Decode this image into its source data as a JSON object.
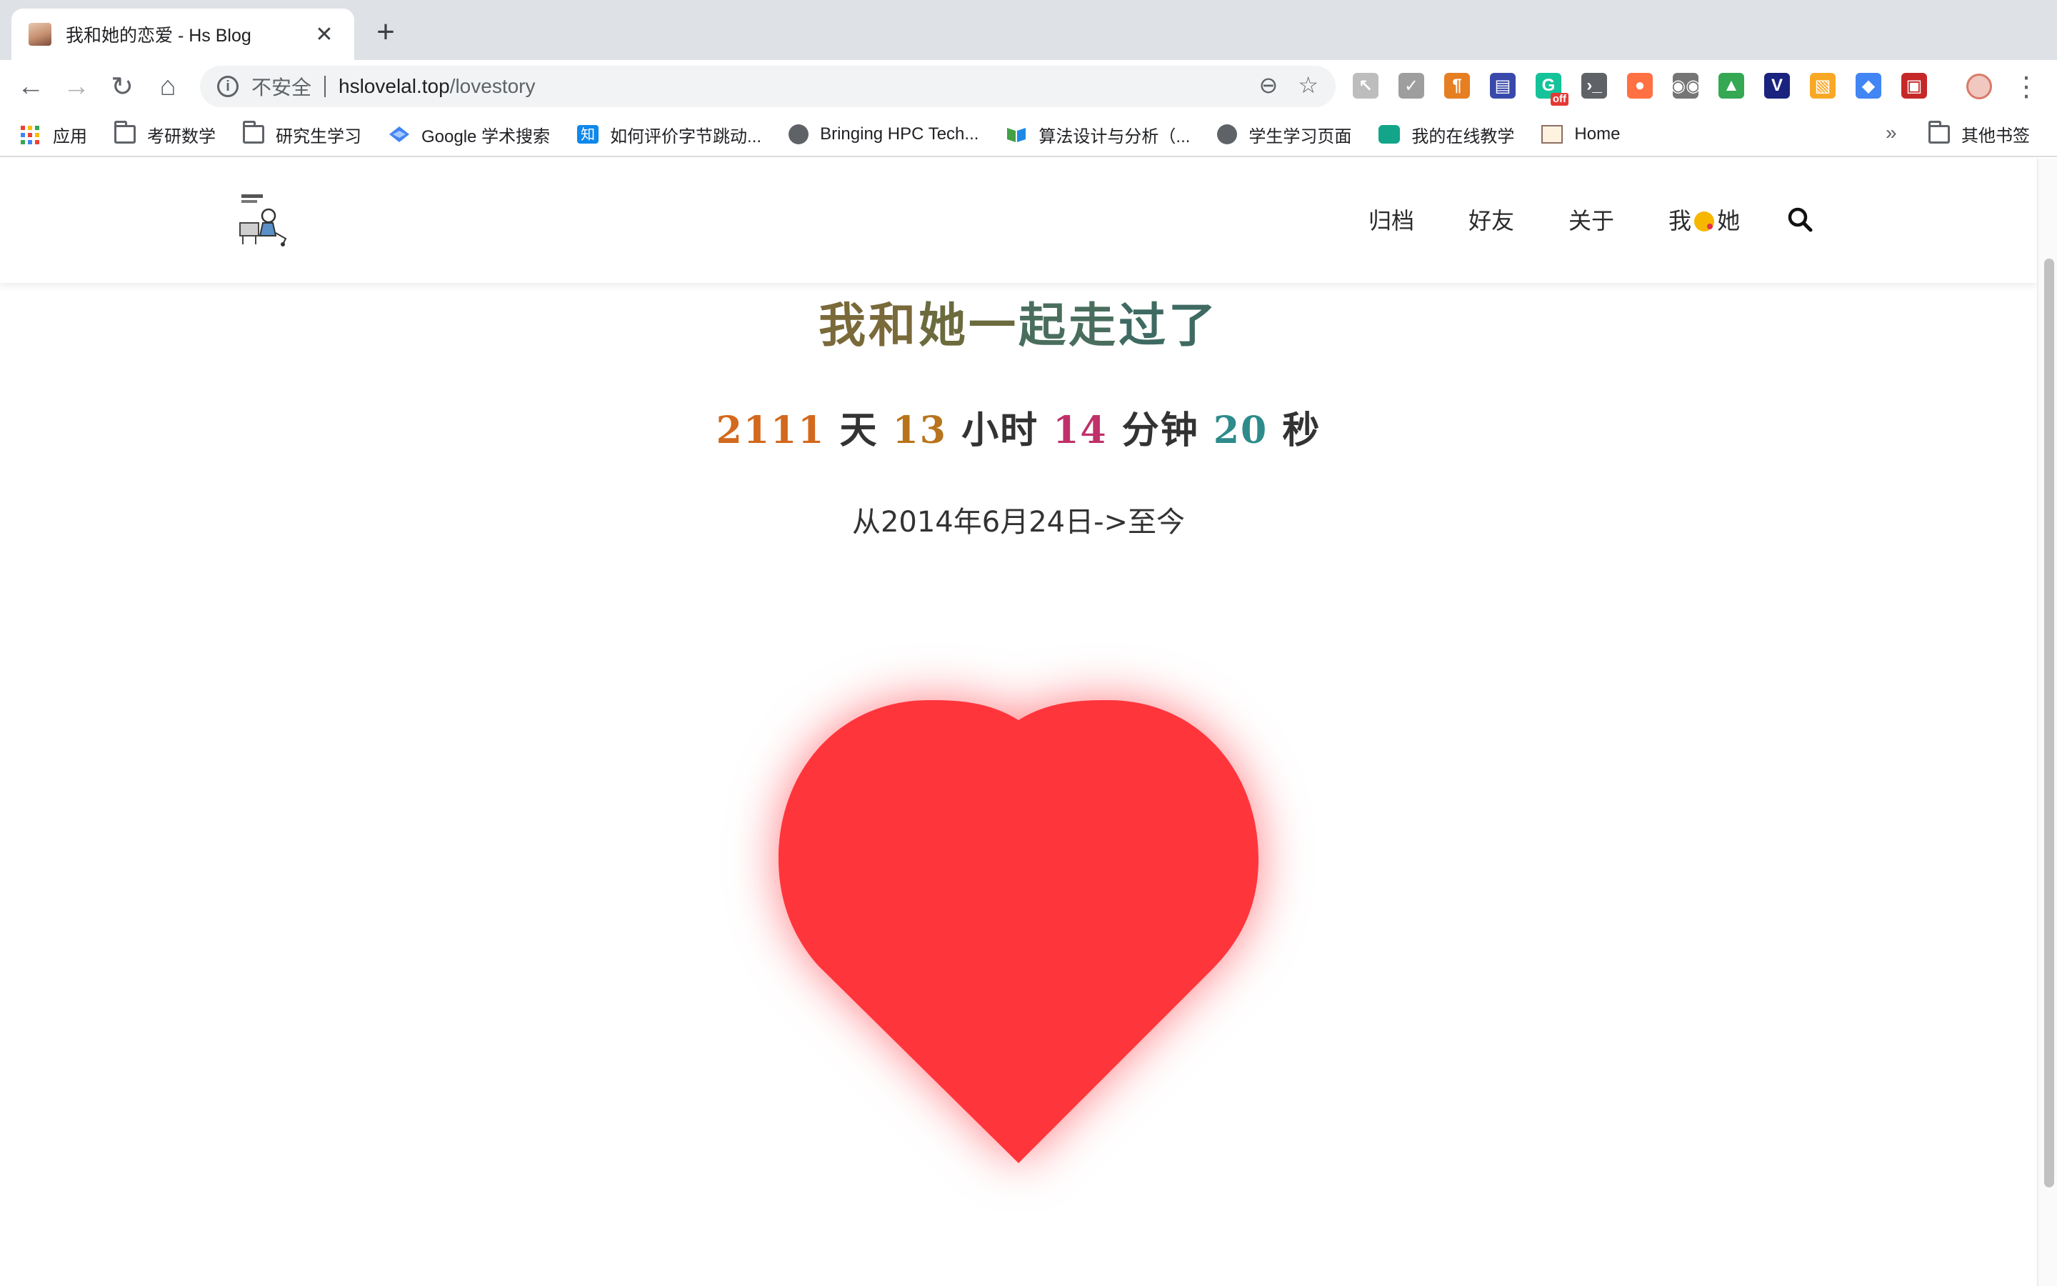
{
  "browser": {
    "tab_title": "我和她的恋爱 - Hs Blog",
    "tab_close": "✕",
    "new_tab": "+",
    "nav": {
      "back": "←",
      "forward": "→",
      "reload": "↻",
      "home": "⌂"
    },
    "omnibox": {
      "info_icon": "i",
      "security_label": "不安全",
      "host": "hslovelal.top",
      "path": "/lovestory",
      "zoom_icon": "⊖",
      "star_icon": "☆"
    },
    "extensions": [
      {
        "name": "cursor-ext",
        "glyph": "↖",
        "color": "#bdbdbd"
      },
      {
        "name": "shield-ext",
        "glyph": "✓",
        "color": "#9e9e9e"
      },
      {
        "name": "pilcrow-ext",
        "glyph": "¶",
        "color": "#e67e22"
      },
      {
        "name": "window-ext",
        "glyph": "▤",
        "color": "#3949ab"
      },
      {
        "name": "grammarly-ext",
        "glyph": "G",
        "color": "#15c39a"
      },
      {
        "name": "terminal-ext",
        "glyph": "›_",
        "color": "#5f6368"
      },
      {
        "name": "toggle-ext",
        "glyph": "●",
        "color": "#ff7043"
      },
      {
        "name": "tampermonkey-ext",
        "glyph": "◉◉",
        "color": "#757575"
      },
      {
        "name": "drive-ext",
        "glyph": "▲",
        "color": "#34a853"
      },
      {
        "name": "vue-ext",
        "glyph": "V",
        "color": "#1a237e"
      },
      {
        "name": "image-ext",
        "glyph": "▧",
        "color": "#f9a825"
      },
      {
        "name": "scholar-ext",
        "glyph": "◆",
        "color": "#4285f4"
      },
      {
        "name": "screen-ext",
        "glyph": "▣",
        "color": "#c62828"
      }
    ],
    "grammarly_badge": "off",
    "menu_icon": "⋮",
    "bookmarks": [
      {
        "label": "应用",
        "icon": "apps-grid-icon"
      },
      {
        "label": "考研数学",
        "icon": "folder-icon"
      },
      {
        "label": "研究生学习",
        "icon": "folder-icon"
      },
      {
        "label": "Google 学术搜索",
        "icon": "scholar-icon"
      },
      {
        "label": "如何评价字节跳动...",
        "icon": "zhihu-icon"
      },
      {
        "label": "Bringing HPC Tech...",
        "icon": "globe-icon"
      },
      {
        "label": "算法设计与分析（...",
        "icon": "book-icon"
      },
      {
        "label": "学生学习页面",
        "icon": "globe-icon"
      },
      {
        "label": "我的在线教学",
        "icon": "teaching-icon"
      },
      {
        "label": "Home",
        "icon": "home-page-icon"
      }
    ],
    "bookmarks_more": "»",
    "other_bookmarks": "其他书签"
  },
  "site": {
    "nav": [
      {
        "label": "归档"
      },
      {
        "label": "好友"
      },
      {
        "label": "关于"
      }
    ],
    "nav_love_left": "我",
    "nav_love_right": "她",
    "title_chars": [
      "我",
      "和",
      "她",
      "一",
      "起",
      "走",
      "过",
      "了"
    ],
    "counter": {
      "days": "2111",
      "days_unit": "天",
      "hours": "13",
      "hours_unit": "小时",
      "minutes": "14",
      "minutes_unit": "分钟",
      "seconds": "20",
      "seconds_unit": "秒"
    },
    "since": "从2014年6月24日->至今",
    "heart_color": "#ff353c"
  }
}
